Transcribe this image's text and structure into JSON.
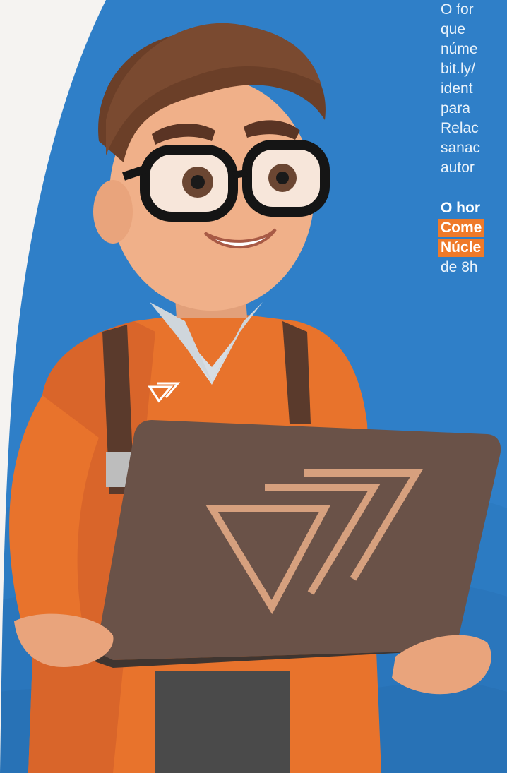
{
  "colors": {
    "background_blue": "#2f7fc8",
    "left_panel": "#f5f3f1",
    "highlight_orange": "#ef7a2a",
    "text_light": "#eaf3fb"
  },
  "text_block": {
    "paragraph_lines": [
      "O for",
      "que",
      "núme",
      "bit.ly/",
      "ident",
      "para",
      "Relac",
      "sanac",
      "autor"
    ],
    "bold_line": "O hor",
    "highlight_1": "Come",
    "highlight_2": "Núcle",
    "last_line": "de 8h"
  },
  "figure": {
    "description_icon": "mascot-with-laptop",
    "logo_icon": "triangle-logo-icon"
  }
}
